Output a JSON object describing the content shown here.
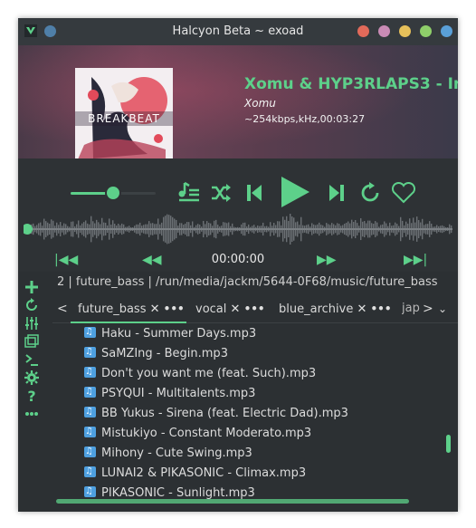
{
  "window": {
    "title": "Halcyon Beta ~ exoad",
    "buttons": [
      {
        "name": "red-button",
        "color": "#e26a5a"
      },
      {
        "name": "pink-button",
        "color": "#c98bb5"
      },
      {
        "name": "yellow-button",
        "color": "#e6c05a"
      },
      {
        "name": "green-button",
        "color": "#8fcf6a"
      },
      {
        "name": "blue-button",
        "color": "#5aa0d8"
      }
    ]
  },
  "now_playing": {
    "cover_text": "BREAKBEAT",
    "title": "Xomu & HYP3RLAPS3 - Ir...",
    "artist": "Xomu",
    "meta": "~254kbps,kHz,00:03:27"
  },
  "controls": {
    "volume": 0.5,
    "time": "00:00:00",
    "accent": "#5dd08a"
  },
  "path": "2 | future_bass | /run/media/jackm/5644-0F68/music/future_bass",
  "tabs": [
    {
      "label": "future_bass",
      "active": true
    },
    {
      "label": "vocal",
      "active": false
    },
    {
      "label": "blue_archive",
      "active": false
    },
    {
      "label": "jap",
      "active": false
    }
  ],
  "files": [
    "Haku - Summer Days.mp3",
    "SaMZIng - Begin.mp3",
    "Don't you want me (feat. Such).mp3",
    "PSYQUI - Multitalents.mp3",
    "BB Yukus - Sirena (feat. Electric Dad).mp3",
    "Mistukiyo - Constant Moderato.mp3",
    "Mihony - Cute Swing.mp3",
    "LUNAI2 & PIKASONIC - Climax.mp3",
    "PIKASONIC - Sunlight.mp3"
  ],
  "icons": {
    "toolbar": [
      "plus-icon",
      "refresh-icon",
      "equalizer-icon",
      "window-icon",
      "terminal-icon",
      "settings-icon",
      "help-icon",
      "more-icon"
    ]
  }
}
